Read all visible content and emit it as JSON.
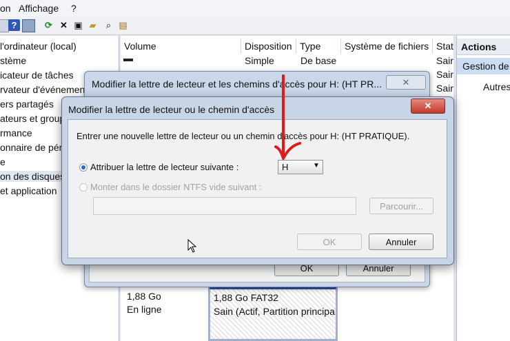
{
  "menu": {
    "item1": "on",
    "item2": "Affichage",
    "item3": "?"
  },
  "tree": {
    "items": [
      "l'ordinateur (local)",
      "stème",
      "icateur de tâches",
      "rvateur d'événement",
      "ers partagés",
      "ateurs et group",
      "rmance",
      "onnaire de pér",
      "e",
      "on des disques",
      "et application"
    ]
  },
  "volume_list": {
    "columns": [
      "Volume",
      "Disposition",
      "Type",
      "Système de fichiers",
      "Stat"
    ],
    "rows": [
      {
        "disposition": "Simple",
        "type": "De base",
        "status": "Sair"
      },
      {
        "status": "Sair"
      },
      {
        "status": "Sair"
      }
    ]
  },
  "actions": {
    "header": "Actions",
    "item1": "Gestion de",
    "item2": "Autres"
  },
  "bg_dialog": {
    "title": "Modifier la lettre de lecteur et les chemins d'accès pour H: (HT PR...",
    "ok": "OK",
    "cancel": "Annuler"
  },
  "disk": {
    "size": "1,88 Go",
    "status": "En ligne",
    "partition_size": "1,88 Go FAT32",
    "partition_status": "Sain (Actif, Partition principa"
  },
  "dialog": {
    "title": "Modifier la lettre de lecteur ou le chemin d'accès",
    "instruction": "Entrer une nouvelle lettre de lecteur ou un chemin d'accès pour H: (HT PRATIQUE).",
    "option_letter": "Attribuer la lettre de lecteur suivante :",
    "letter_value": "H",
    "option_mount": "Monter dans le dossier NTFS vide suivant :",
    "browse": "Parcourir...",
    "ok": "OK",
    "cancel": "Annuler"
  },
  "colors": {
    "annotation_arrow": "#e01b1b",
    "close_button": "#c94a3b"
  }
}
